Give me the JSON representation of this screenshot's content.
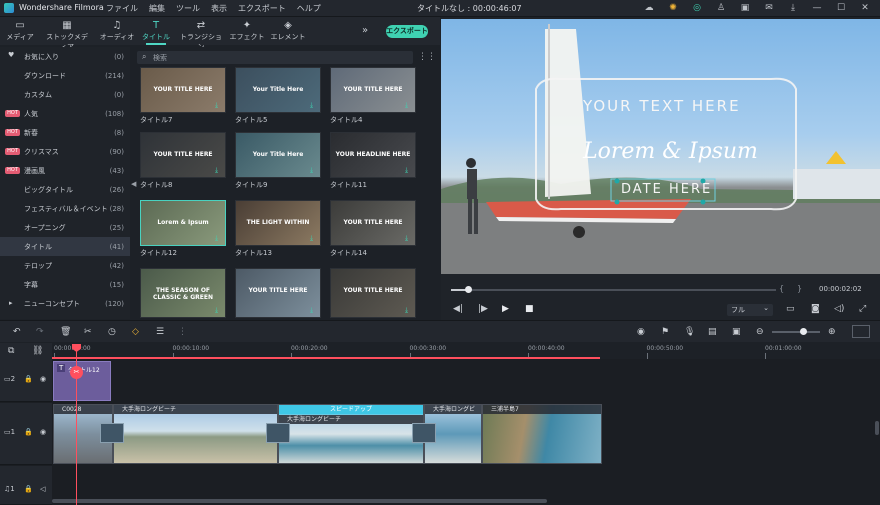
{
  "titlebar": {
    "app_name": "Wondershare Filmora",
    "menu": [
      "ファイル",
      "編集",
      "ツール",
      "表示",
      "エクスポート",
      "ヘルプ"
    ],
    "project_title": "タイトルなし : 00:00:46:07"
  },
  "toolbar": {
    "tabs": [
      {
        "label": "メディア",
        "icon": "folder-icon"
      },
      {
        "label": "ストックメディア",
        "icon": "stock-icon"
      },
      {
        "label": "オーディオ",
        "icon": "music-icon"
      },
      {
        "label": "タイトル",
        "icon": "text-icon"
      },
      {
        "label": "トランジション",
        "icon": "transition-icon"
      },
      {
        "label": "エフェクト",
        "icon": "effect-icon"
      },
      {
        "label": "エレメント",
        "icon": "element-icon"
      }
    ],
    "active_tab": "タイトル",
    "export_label": "エクスポート"
  },
  "sidebar": {
    "items": [
      {
        "label": "お気に入り",
        "count": "(0)"
      },
      {
        "label": "ダウンロード",
        "count": "(214)"
      },
      {
        "label": "カスタム",
        "count": "(0)"
      },
      {
        "label": "人気",
        "count": "(108)",
        "badge": "HOT"
      },
      {
        "label": "新春",
        "count": "(8)",
        "badge": "HOT"
      },
      {
        "label": "クリスマス",
        "count": "(90)",
        "badge": "HOT"
      },
      {
        "label": "漫画風",
        "count": "(43)",
        "badge": "HOT"
      },
      {
        "label": "ビッグタイトル",
        "count": "(26)"
      },
      {
        "label": "フェスティバル＆イベント",
        "count": "(28)"
      },
      {
        "label": "オープニング",
        "count": "(25)"
      },
      {
        "label": "タイトル",
        "count": "(41)"
      },
      {
        "label": "テロップ",
        "count": "(42)"
      },
      {
        "label": "字幕",
        "count": "(15)"
      },
      {
        "label": "ニューコンセプト",
        "count": "(120)"
      }
    ],
    "selected": "タイトル"
  },
  "search": {
    "placeholder": "検索"
  },
  "grid": {
    "items": [
      {
        "label": "タイトル7",
        "text": "YOUR TITLE HERE"
      },
      {
        "label": "タイトル5",
        "text": "Your Title Here"
      },
      {
        "label": "タイトル4",
        "text": "YOUR TITLE HERE"
      },
      {
        "label": "タイトル8",
        "text": "YOUR TITLE HERE"
      },
      {
        "label": "タイトル9",
        "text": "Your Title Here"
      },
      {
        "label": "タイトル11",
        "text": "YOUR HEADLINE HERE"
      },
      {
        "label": "タイトル12",
        "text": "Lorem & Ipsum"
      },
      {
        "label": "タイトル13",
        "text": "THE LIGHT WITHIN"
      },
      {
        "label": "タイトル14",
        "text": "YOUR TITLE HERE"
      },
      {
        "label": "",
        "text": "THE SEASON OF CLASSIC & GREEN"
      },
      {
        "label": "",
        "text": "YOUR TITLE HERE"
      },
      {
        "label": "",
        "text": "YOUR TITLE HERE"
      }
    ]
  },
  "preview": {
    "overlay_line1": "YOUR TEXT HERE",
    "overlay_line2": "Lorem & Ipsum",
    "overlay_line3": "DATE HERE",
    "timecode": "00:00:02:02",
    "zoom": "フル"
  },
  "timeline": {
    "ruler": [
      "00:00:00:00",
      "00:00:10:00",
      "00:00:20:00",
      "00:00:30:00",
      "00:00:40:00",
      "00:00:50:00",
      "00:01:00:00"
    ],
    "clips": {
      "title_clip": "タイトル12",
      "video1": "C0028",
      "video2": "大手海ロングビーチ",
      "video3_tag": "スピードアップ",
      "video3": "大手海ロングビーチ",
      "video4": "大手海ロングビ",
      "video5": "三浦半島7"
    }
  },
  "colors": {
    "accent": "#3fd2b2",
    "hot_badge": "#e45c73",
    "playhead": "#ff4f5e"
  }
}
